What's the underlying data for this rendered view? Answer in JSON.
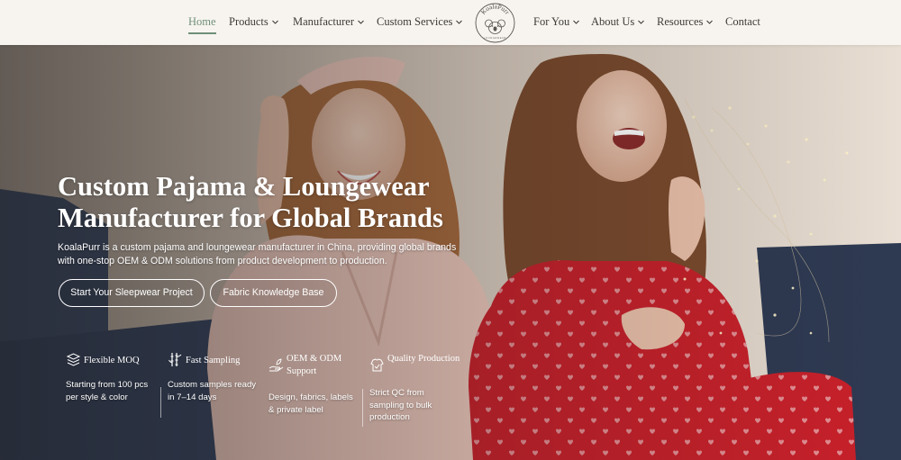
{
  "nav": {
    "items": [
      {
        "label": "Home",
        "dropdown": false,
        "active": true
      },
      {
        "label": "Products",
        "dropdown": true,
        "active": false
      },
      {
        "label": "Manufacturer",
        "dropdown": true,
        "active": false
      },
      {
        "label": "Custom Services",
        "dropdown": true,
        "active": false
      },
      {
        "label": "For You",
        "dropdown": true,
        "active": false
      },
      {
        "label": "About Us",
        "dropdown": true,
        "active": false
      },
      {
        "label": "Resources",
        "dropdown": true,
        "active": false
      },
      {
        "label": "Contact",
        "dropdown": false,
        "active": false
      }
    ],
    "logo_text": "KoalaPurr",
    "logo_subtext": "LOUNGEWEAR"
  },
  "hero": {
    "headline_line1": "Custom Pajama & Loungewear",
    "headline_line2": "Manufacturer for Global Brands",
    "subtext": "KoalaPurr is a custom pajama and loungewear manufacturer in China, providing global brands with one-stop OEM & ODM solutions from product development to production.",
    "primary_button": "Start Your Sleepwear Project",
    "secondary_button": "Fabric Knowledge Base"
  },
  "features": [
    {
      "icon": "layers-icon",
      "title": "Flexible MOQ",
      "description": "Starting from 100 pcs per style & color"
    },
    {
      "icon": "bamboo-icon",
      "title": "Fast Sampling",
      "description": "Custom samples ready in 7–14 days"
    },
    {
      "icon": "hand-leaf-icon",
      "title": "OEM & ODM Support",
      "description": "Design, fabrics, labels & private label"
    },
    {
      "icon": "quality-shirt-icon",
      "title": "Quality Production",
      "description": "Strict QC from sampling to bulk production"
    }
  ],
  "colors": {
    "header_bg": "#f7f4ef",
    "accent": "#6f8f78",
    "pajama_red": "#c8202a",
    "pajama_pink": "#eec9bd",
    "sofa_blue": "#3b4a66"
  }
}
